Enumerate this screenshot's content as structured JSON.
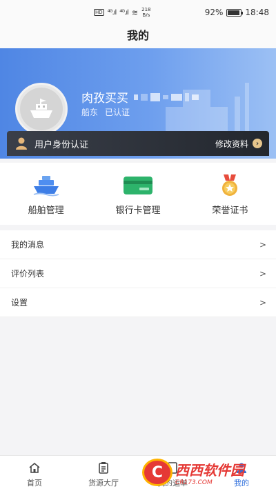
{
  "status_bar": {
    "signal_a": "⁴ᴳ.ıl",
    "signal_b": "⁴ᴳ.ıl",
    "net_speed": "218",
    "net_unit": "B/s",
    "battery": "92%",
    "battery_level": 0.92,
    "time": "18:48"
  },
  "nav": {
    "title": "我的"
  },
  "profile": {
    "name": "肉孜买买",
    "role": "船东",
    "status": "已认证"
  },
  "auth_bar": {
    "label": "用户身份认证",
    "edit_label": "修改资料",
    "edit_icon": "chevron-right-icon"
  },
  "functions": [
    {
      "label": "船舶管理",
      "icon": "ship-icon"
    },
    {
      "label": "银行卡管理",
      "icon": "bank-card-icon"
    },
    {
      "label": "荣誉证书",
      "icon": "medal-icon"
    }
  ],
  "menu": [
    {
      "label": "我的消息",
      "chevron": ">"
    },
    {
      "label": "评价列表",
      "chevron": ">"
    },
    {
      "label": "设置",
      "chevron": ">"
    }
  ],
  "tabs": [
    {
      "label": "首页",
      "icon": "home-icon"
    },
    {
      "label": "货源大厅",
      "icon": "clipboard-icon"
    },
    {
      "label": "我的运单",
      "icon": "waybill-icon"
    },
    {
      "label": "我的",
      "icon": "user-icon"
    }
  ],
  "colors": {
    "accent": "#2f6fdc",
    "header_blue": "#4f86e4",
    "auth_bar": "#2b2f36",
    "medal_gold": "#e6a23c",
    "card_green": "#2db36b"
  },
  "watermark": {
    "logo_char": "C",
    "brand": "西西软件园",
    "site": "CR173.COM"
  }
}
